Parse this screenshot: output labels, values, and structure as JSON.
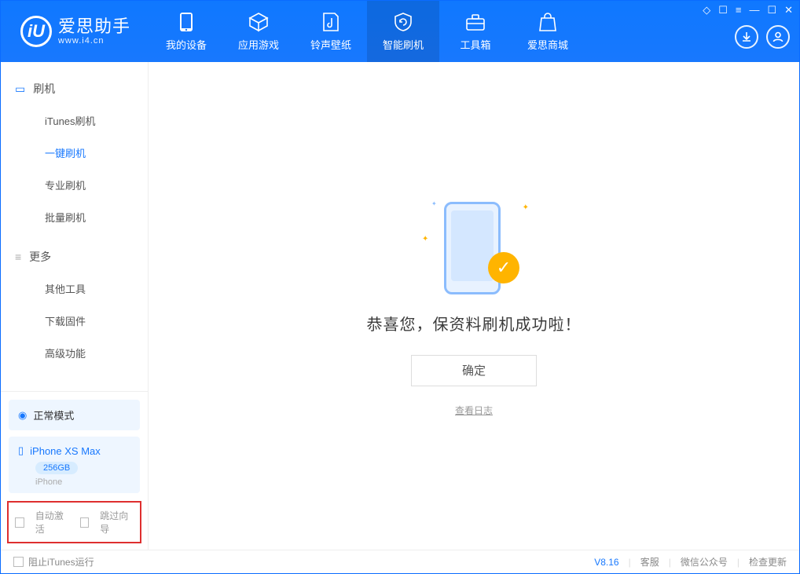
{
  "app": {
    "title": "爱思助手",
    "subtitle": "www.i4.cn"
  },
  "tabs": [
    {
      "label": "我的设备"
    },
    {
      "label": "应用游戏"
    },
    {
      "label": "铃声壁纸"
    },
    {
      "label": "智能刷机"
    },
    {
      "label": "工具箱"
    },
    {
      "label": "爱思商城"
    }
  ],
  "sidebar": {
    "group1": {
      "title": "刷机",
      "items": [
        "iTunes刷机",
        "一键刷机",
        "专业刷机",
        "批量刷机"
      ]
    },
    "group2": {
      "title": "更多",
      "items": [
        "其他工具",
        "下载固件",
        "高级功能"
      ]
    },
    "mode_label": "正常模式",
    "device": {
      "name": "iPhone XS Max",
      "capacity": "256GB",
      "type": "iPhone"
    },
    "opt_auto_activate": "自动激活",
    "opt_skip_guide": "跳过向导"
  },
  "main": {
    "success_text": "恭喜您，保资料刷机成功啦！",
    "ok_button": "确定",
    "view_log": "查看日志"
  },
  "footer": {
    "block_itunes": "阻止iTunes运行",
    "version": "V8.16",
    "link_service": "客服",
    "link_wechat": "微信公众号",
    "link_update": "检查更新"
  }
}
